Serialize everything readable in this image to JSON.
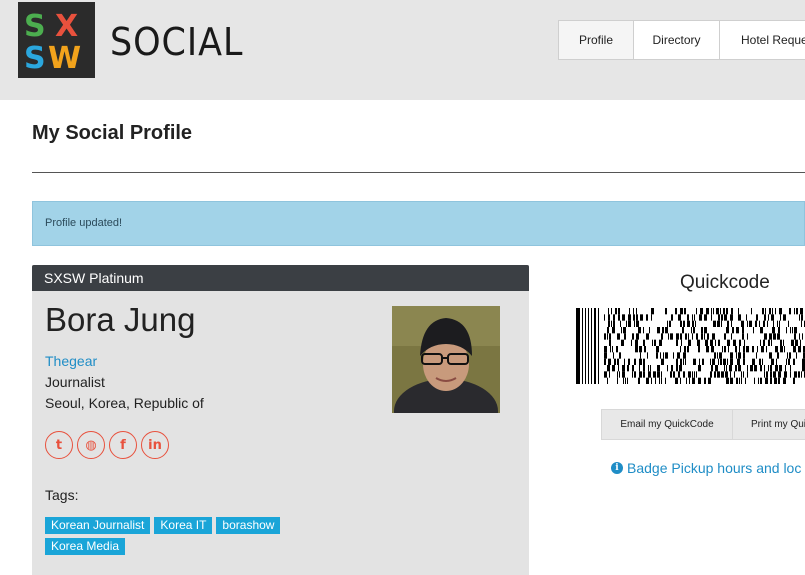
{
  "header": {
    "logo_letters": [
      "S",
      "X",
      "S",
      "W"
    ],
    "brand": "SOCIAL",
    "nav": [
      {
        "label": "Profile"
      },
      {
        "label": "Directory"
      },
      {
        "label": "Hotel Reque"
      }
    ]
  },
  "page": {
    "title": "My Social Profile",
    "alert": "Profile updated!"
  },
  "profile": {
    "badge_type": "SXSW Platinum",
    "name": "Bora Jung",
    "company": "Thegear",
    "job_title": "Journalist",
    "location": "Seoul, Korea, Republic of",
    "socials": [
      {
        "icon": "twitter-icon",
        "glyph": "t"
      },
      {
        "icon": "globe-icon",
        "glyph": "◍"
      },
      {
        "icon": "facebook-icon",
        "glyph": "f"
      },
      {
        "icon": "linkedin-icon",
        "glyph": "in"
      }
    ],
    "tags_label": "Tags:",
    "tags": [
      "Korean Journalist",
      "Korea IT",
      "borashow",
      "Korea Media"
    ]
  },
  "quickcode": {
    "title": "Quickcode",
    "email_button": "Email my QuickCode",
    "print_button": "Print my Qui",
    "badge_link": "Badge Pickup hours and loc"
  },
  "colors": {
    "header_bg": "#e6e6e6",
    "alert_bg": "#a2d3e8",
    "card_header_bg": "#3b3f44",
    "link": "#1f8dc6",
    "social_accent": "#e8513d",
    "tag_bg": "#1aa5d8"
  }
}
